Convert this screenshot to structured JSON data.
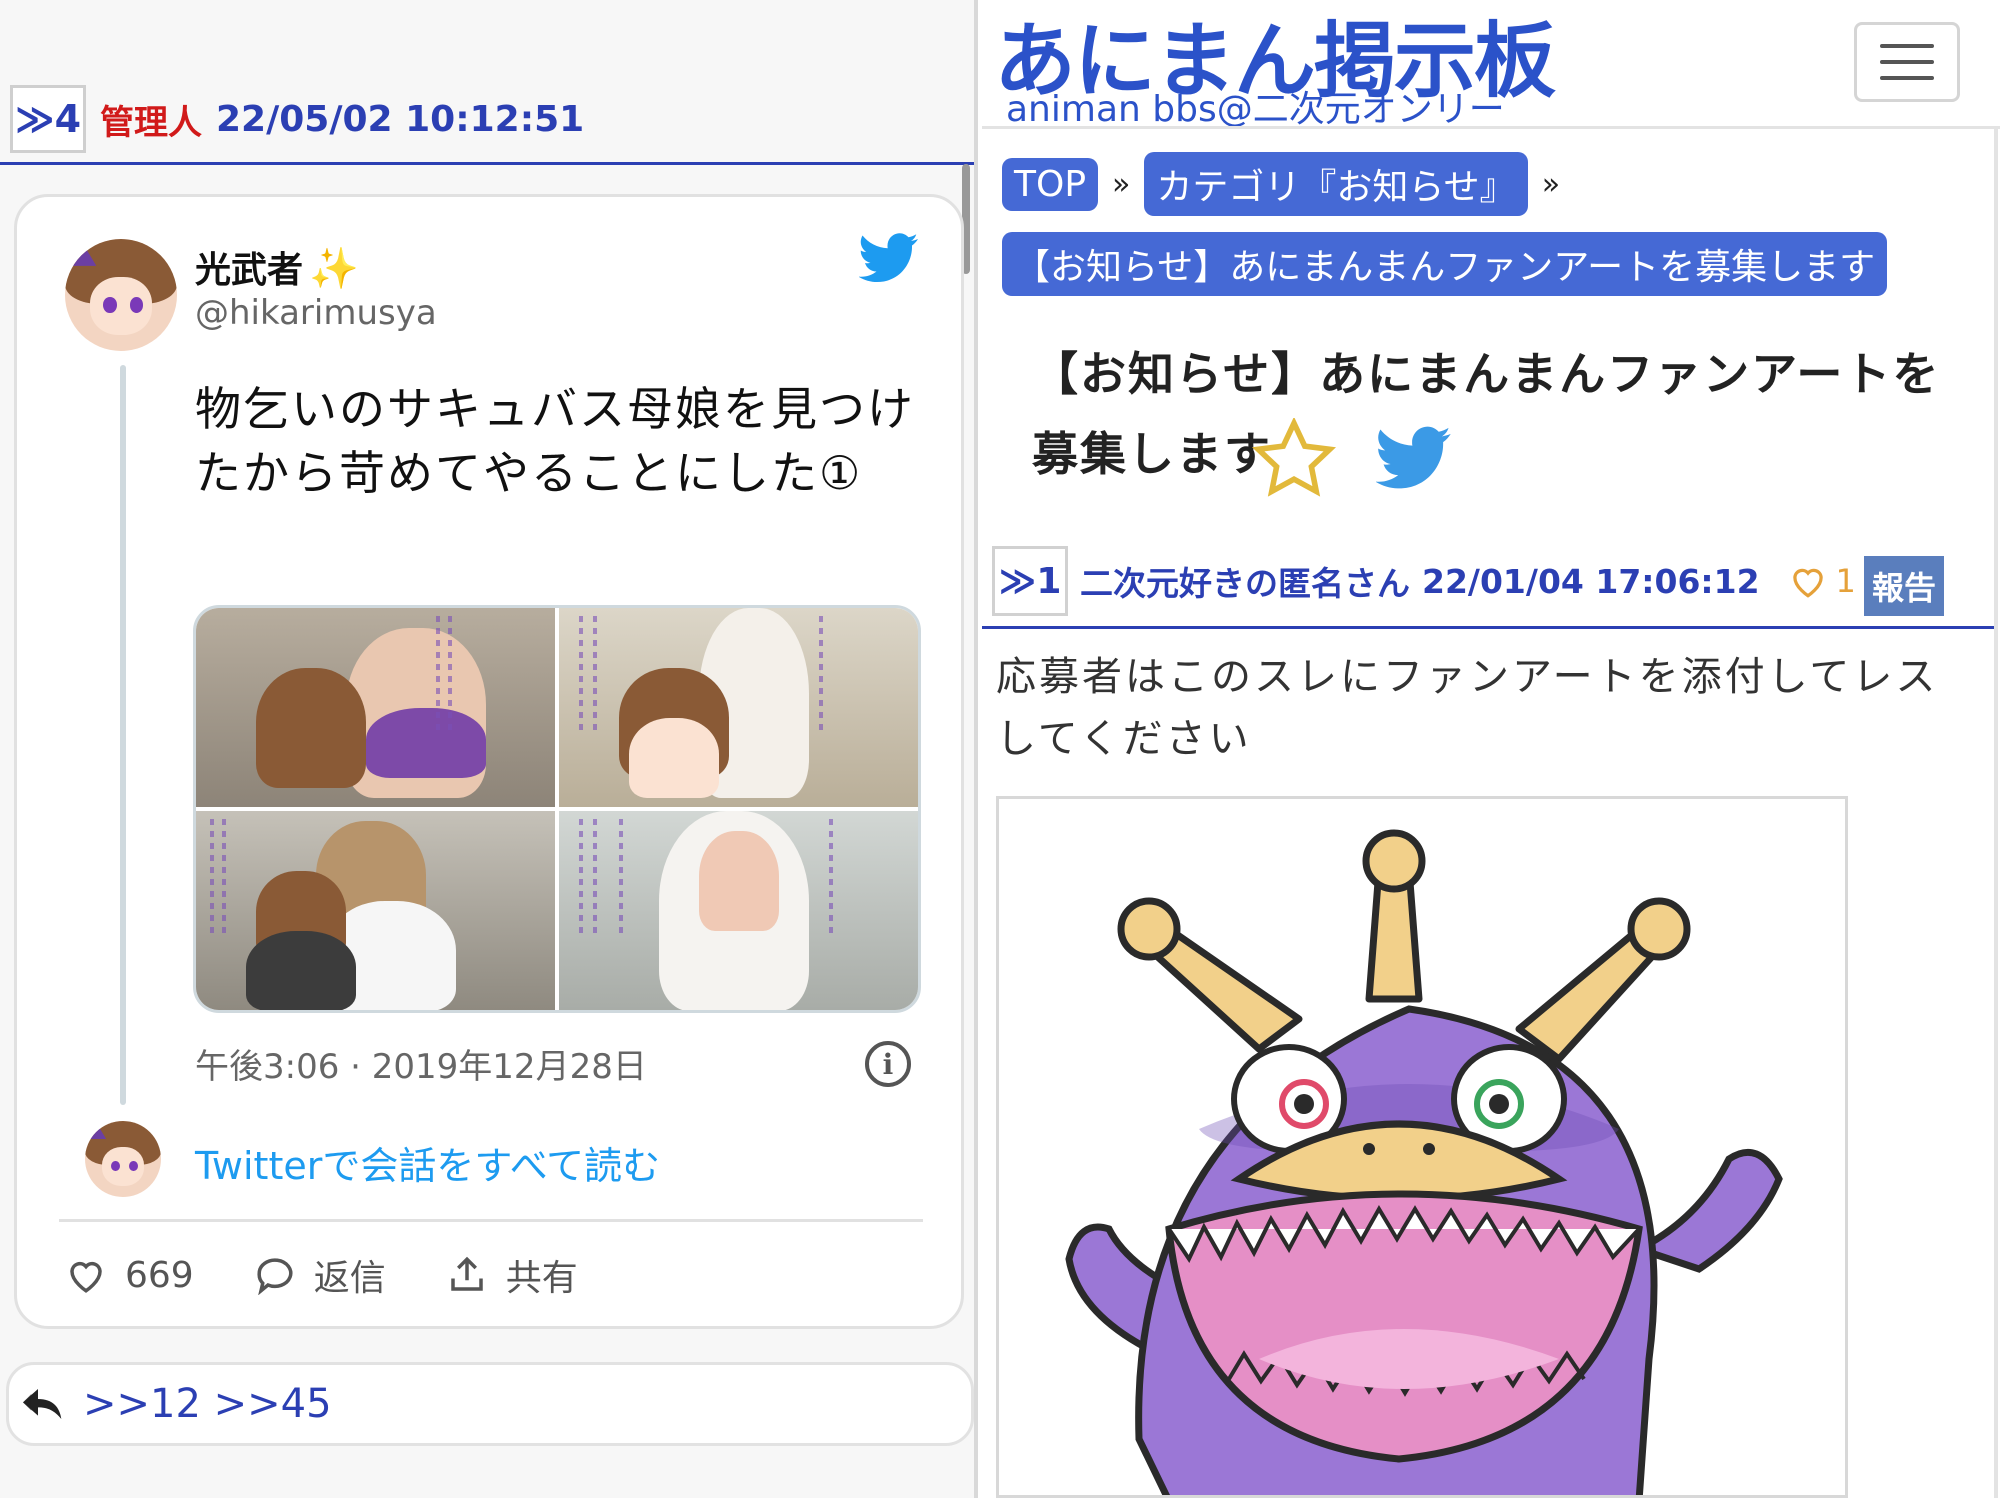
{
  "left": {
    "post": {
      "res_number": "≫4",
      "poster": "管理人",
      "date": "22/05/02 10:12:51"
    },
    "tweet": {
      "display_name": "光武者",
      "name_emoji": "✨",
      "handle": "@hikarimusya",
      "text": "物乞いのサキュバス母娘を見つけたから苛めてやることにした①",
      "timestamp": "午後3:06 · 2019年12月28日",
      "read_all": "Twitterで会話をすべて読む",
      "likes": "669",
      "reply_label": "返信",
      "share_label": "共有"
    },
    "replies": {
      "anchors": ">>12 >>45"
    }
  },
  "right": {
    "site": {
      "title": "あにまん掲示板",
      "subtitle": "animan bbs@二次元オンリー"
    },
    "breadcrumbs": [
      {
        "label": "TOP"
      },
      {
        "label": "カテゴリ『お知らせ』"
      },
      {
        "label": "【お知らせ】あにまんまんファンアートを募集します"
      }
    ],
    "breadcrumb_separator": "»",
    "thread_title": "【お知らせ】あにまんまんファンアートを募集します",
    "post": {
      "res_number": "≫1",
      "poster": "二次元好きの匿名さん",
      "date": "22/01/04 17:06:12",
      "likes": "1",
      "report_label": "報告",
      "body": "応募者はこのスレにファンアートを添付してレスしてください"
    }
  },
  "colors": {
    "link_blue": "#2b3fb3",
    "site_blue": "#2b52c9",
    "crumb_bg": "#4569d5",
    "admin_red": "#d11a1a",
    "twitter_blue": "#1d9bf0",
    "like_orange": "#e5a13a",
    "mascot_purple": "#9b77d6",
    "mascot_horn": "#f2d08a",
    "mascot_mouth": "#e58fc6"
  },
  "icons": [
    "reply-arrow-icon",
    "twitter-bird-icon",
    "heart-icon",
    "comment-icon",
    "share-icon",
    "info-icon",
    "star-icon",
    "menu-icon"
  ]
}
